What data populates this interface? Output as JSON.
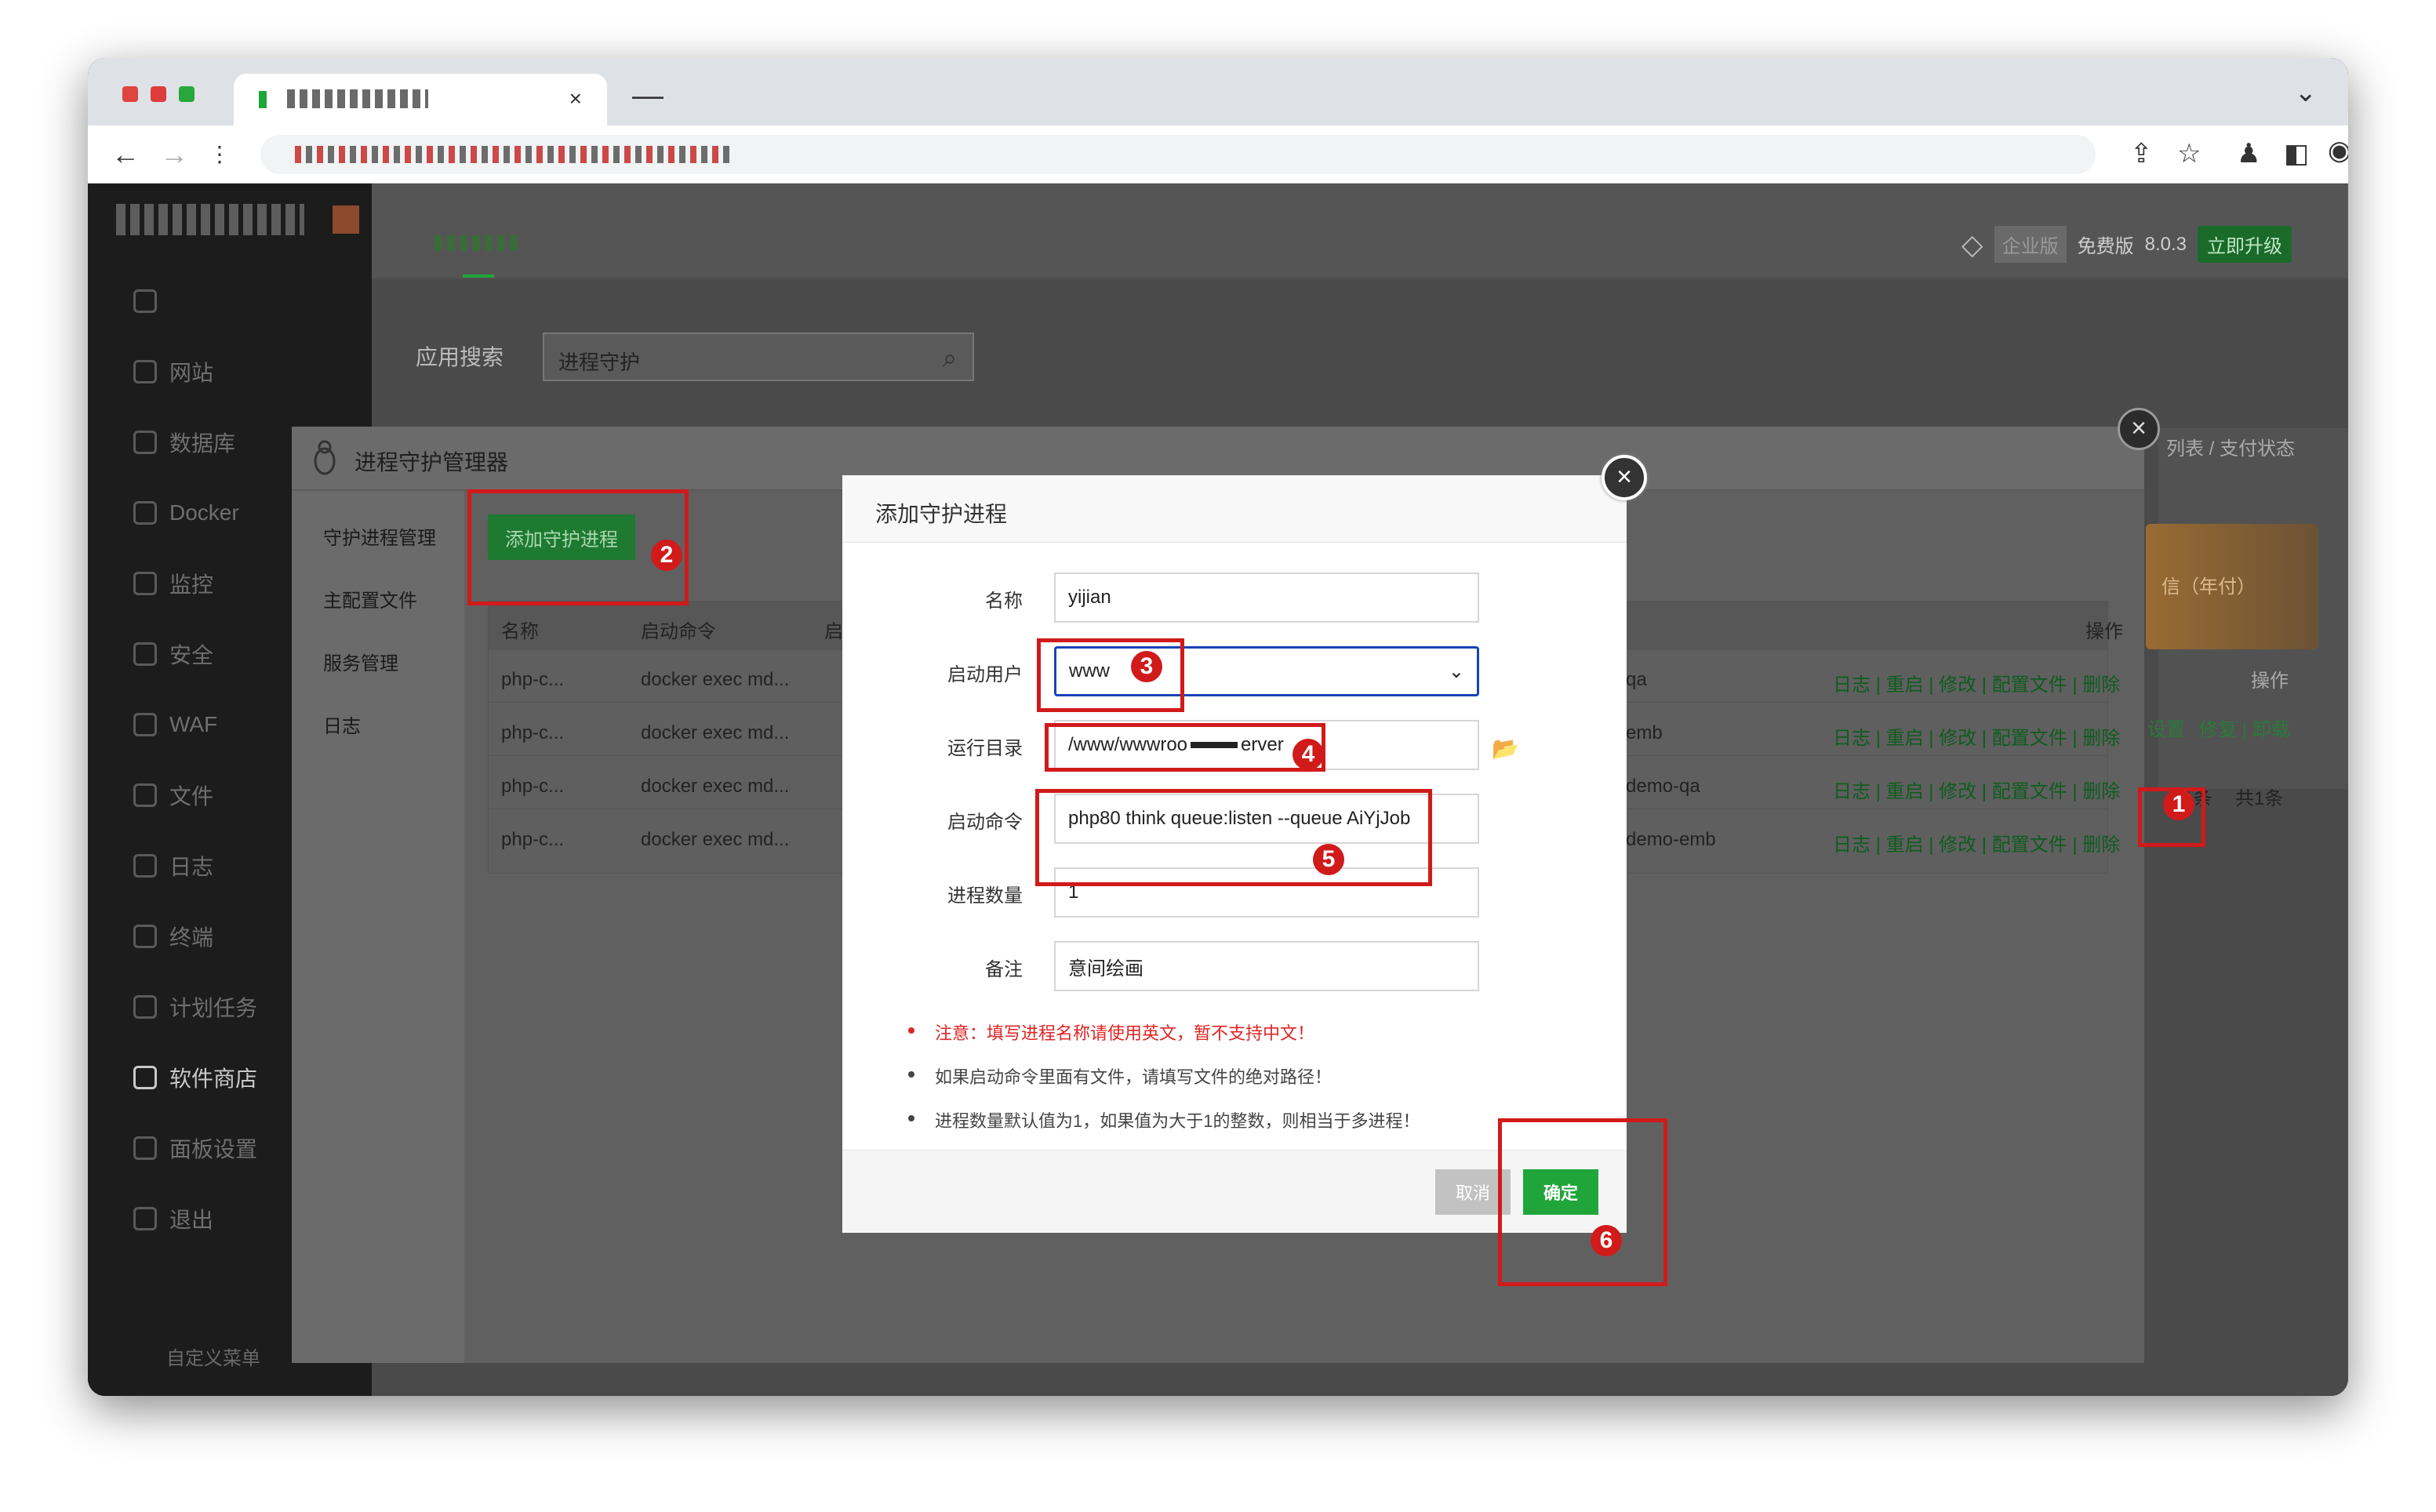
{
  "browser": {
    "tab_close": "×",
    "new_tab": "—",
    "tab_menu": "⌄"
  },
  "sidebar": {
    "items": [
      {
        "label": "网站"
      },
      {
        "label": "数据库"
      },
      {
        "label": "Docker"
      },
      {
        "label": "监控"
      },
      {
        "label": "安全"
      },
      {
        "label": "WAF"
      },
      {
        "label": "文件"
      },
      {
        "label": "日志"
      },
      {
        "label": "终端"
      },
      {
        "label": "计划任务"
      },
      {
        "label": "软件商店"
      },
      {
        "label": "面板设置"
      },
      {
        "label": "退出"
      }
    ],
    "custom_menu": "自定义菜单"
  },
  "header": {
    "enterprise": "企业版",
    "free": "免费版",
    "version": "8.0.3",
    "upgrade": "立即升级"
  },
  "app_search": {
    "label": "应用搜索",
    "value": "进程守护"
  },
  "bg_right": {
    "list_text": "列表 / 支付状态",
    "annual": "信（年付）",
    "ops_header": "操作",
    "row_actions_1": "设置",
    "row_actions_2": "修复 | 卸载",
    "pager_1": "1-1条",
    "pager_2": "共1条"
  },
  "manager": {
    "title": "进程守护管理器",
    "close": "×",
    "menu": [
      "守护进程管理",
      "主配置文件",
      "服务管理",
      "日志"
    ],
    "add_button": "添加守护进程",
    "columns": {
      "name": "名称",
      "command": "启动命令",
      "col3": "启",
      "ops": "操作"
    },
    "rows": [
      {
        "name": "php-c...",
        "cmd": "docker exec md...",
        "tail": "qa",
        "actions": "日志 | 重启 | 修改 | 配置文件 | 删除"
      },
      {
        "name": "php-c...",
        "cmd": "docker exec md...",
        "tail": "emb",
        "actions": "日志 | 重启 | 修改 | 配置文件 | 删除"
      },
      {
        "name": "php-c...",
        "cmd": "docker exec md...",
        "tail": "demo-qa",
        "actions": "日志 | 重启 | 修改 | 配置文件 | 删除"
      },
      {
        "name": "php-c...",
        "cmd": "docker exec md...",
        "tail": "demo-emb",
        "actions": "日志 | 重启 | 修改 | 配置文件 | 删除"
      }
    ]
  },
  "dialog": {
    "title": "添加守护进程",
    "close": "×",
    "fields": {
      "name_label": "名称",
      "name_value": "yijian",
      "user_label": "启动用户",
      "user_value": "www",
      "dir_label": "运行目录",
      "dir_value": "/www/wwwroo",
      "dir_value_tail": "erver",
      "cmd_label": "启动命令",
      "cmd_value": "php80 think queue:listen --queue AiYjJob",
      "count_label": "进程数量",
      "count_value": "1",
      "remark_label": "备注",
      "remark_value": "意间绘画"
    },
    "notes": [
      "注意：填写进程名称请使用英文，暂不支持中文！",
      "如果启动命令里面有文件，请填写文件的绝对路径！",
      "进程数量默认值为1，如果值为大于1的整数，则相当于多进程！"
    ],
    "cancel": "取消",
    "ok": "确定"
  },
  "markers": [
    "1",
    "2",
    "3",
    "4",
    "5",
    "6"
  ],
  "colors": {
    "accent": "#20a53a",
    "annotation": "#d11a1a",
    "select_border": "#1a43b8"
  }
}
